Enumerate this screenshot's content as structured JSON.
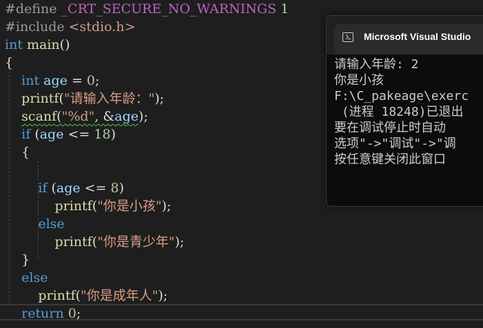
{
  "editor": {
    "lines": [
      {
        "segments": [
          {
            "t": "#define ",
            "c": "pp"
          },
          {
            "t": "_CRT_SECURE_NO_WARNINGS",
            "c": "macro"
          },
          {
            "t": " 1",
            "c": "num"
          }
        ]
      },
      {
        "segments": [
          {
            "t": "#include ",
            "c": "pp"
          },
          {
            "t": "<stdio.h>",
            "c": "inc"
          }
        ]
      },
      {
        "segments": [
          {
            "t": "int",
            "c": "kw"
          },
          {
            "t": " ",
            "c": ""
          },
          {
            "t": "main",
            "c": "fn"
          },
          {
            "t": "()",
            "c": ""
          }
        ]
      },
      {
        "segments": [
          {
            "t": "{",
            "c": ""
          }
        ]
      },
      {
        "segments": [
          {
            "t": "    ",
            "c": ""
          },
          {
            "t": "int",
            "c": "kw"
          },
          {
            "t": " ",
            "c": ""
          },
          {
            "t": "age",
            "c": "var"
          },
          {
            "t": " = ",
            "c": ""
          },
          {
            "t": "0",
            "c": "num"
          },
          {
            "t": ";",
            "c": ""
          }
        ]
      },
      {
        "segments": [
          {
            "t": "    ",
            "c": ""
          },
          {
            "t": "printf",
            "c": "fn"
          },
          {
            "t": "(",
            "c": ""
          },
          {
            "t": "\"请输入年龄：\"",
            "c": "str"
          },
          {
            "t": ");",
            "c": ""
          }
        ]
      },
      {
        "segments": [
          {
            "t": "    ",
            "c": ""
          },
          {
            "t": "scanf",
            "c": "fn squiggle"
          },
          {
            "t": "(",
            "c": "squiggle"
          },
          {
            "t": "\"%d\"",
            "c": "str squiggle"
          },
          {
            "t": ", &",
            "c": "squiggle"
          },
          {
            "t": "age",
            "c": "var squiggle"
          },
          {
            "t": ");",
            "c": ""
          }
        ]
      },
      {
        "segments": [
          {
            "t": "    ",
            "c": ""
          },
          {
            "t": "if",
            "c": "kw"
          },
          {
            "t": " (",
            "c": ""
          },
          {
            "t": "age",
            "c": "var"
          },
          {
            "t": " <= ",
            "c": ""
          },
          {
            "t": "18",
            "c": "num"
          },
          {
            "t": ")",
            "c": ""
          }
        ]
      },
      {
        "segments": [
          {
            "t": "    {",
            "c": ""
          }
        ]
      },
      {
        "segments": [
          {
            "t": "",
            "c": ""
          }
        ]
      },
      {
        "segments": [
          {
            "t": "        ",
            "c": ""
          },
          {
            "t": "if",
            "c": "kw"
          },
          {
            "t": " (",
            "c": ""
          },
          {
            "t": "age",
            "c": "var"
          },
          {
            "t": " <= ",
            "c": ""
          },
          {
            "t": "8",
            "c": "num"
          },
          {
            "t": ")",
            "c": ""
          }
        ]
      },
      {
        "segments": [
          {
            "t": "            ",
            "c": ""
          },
          {
            "t": "printf",
            "c": "fn"
          },
          {
            "t": "(",
            "c": ""
          },
          {
            "t": "\"你是小孩\"",
            "c": "str"
          },
          {
            "t": ");",
            "c": ""
          }
        ]
      },
      {
        "segments": [
          {
            "t": "        ",
            "c": ""
          },
          {
            "t": "else",
            "c": "kw"
          }
        ]
      },
      {
        "segments": [
          {
            "t": "            ",
            "c": ""
          },
          {
            "t": "printf",
            "c": "fn"
          },
          {
            "t": "(",
            "c": ""
          },
          {
            "t": "\"你是青少年\"",
            "c": "str"
          },
          {
            "t": ");",
            "c": ""
          }
        ]
      },
      {
        "segments": [
          {
            "t": "    }",
            "c": ""
          }
        ]
      },
      {
        "segments": [
          {
            "t": "    ",
            "c": ""
          },
          {
            "t": "else",
            "c": "kw"
          }
        ]
      },
      {
        "segments": [
          {
            "t": "        ",
            "c": ""
          },
          {
            "t": "printf",
            "c": "fn"
          },
          {
            "t": "(",
            "c": ""
          },
          {
            "t": "\"你是成年人\"",
            "c": "str"
          },
          {
            "t": ");",
            "c": ""
          }
        ]
      },
      {
        "segments": [
          {
            "t": "    ",
            "c": ""
          },
          {
            "t": "return",
            "c": "kw"
          },
          {
            "t": " ",
            "c": ""
          },
          {
            "t": "0",
            "c": "num"
          },
          {
            "t": ";",
            "c": ""
          }
        ]
      }
    ],
    "colors": {
      "background": "#1e1e1e",
      "keyword": "#569cd6",
      "string": "#d69d85",
      "function": "#dcdcaa",
      "variable": "#9cdcfe",
      "preprocessor": "#9b9b9b",
      "macro": "#bd63c5",
      "squiggle": "#4ec94e"
    }
  },
  "console": {
    "icon": "terminal-icon",
    "title": "Microsoft Visual Studio",
    "lines": [
      "请输入年龄: 2",
      "你是小孩",
      "F:\\C_pakeage\\exerc",
      " (进程 18248)已退出",
      "要在调试停止时自动",
      "选项\"->\"调试\"->\"调",
      "按任意键关闭此窗口"
    ]
  }
}
